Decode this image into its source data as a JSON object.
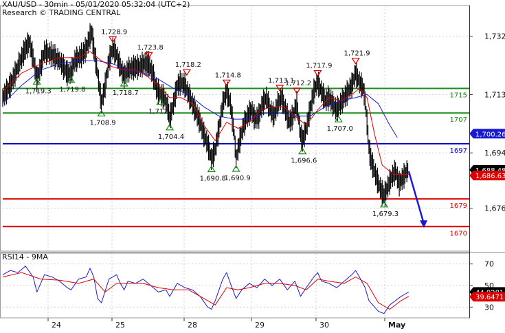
{
  "header": {
    "line1": "XAU/USD - 30min - 05/01/2020 05:32:04 (UTC+2)",
    "line2": "Research © TRADING CENTRAL"
  },
  "rsi_title": "RSI14 - 9MA",
  "colors": {
    "candle": "#000000",
    "fast_ma": "#dd0000",
    "slow_ma": "#1a1ad0",
    "support": "#1a8a1a",
    "resistance": "#dd0000",
    "pivot": "#0000cc",
    "price_tag": "#000000",
    "red_tag": "#dd0000",
    "blue_tag": "#1a1ad0",
    "grid": "#cfcfcf"
  },
  "chart_data": [
    {
      "type": "line",
      "name": "price",
      "ylim": [
        1662,
        1742
      ],
      "x_ticks": [
        "24",
        "25",
        "28",
        "29",
        "30",
        "May"
      ],
      "y_ticks": [
        1732,
        1713,
        1694,
        1676
      ],
      "horizontal_lines": [
        {
          "value": 1715,
          "label": "1715",
          "role": "support"
        },
        {
          "value": 1707,
          "label": "1707",
          "role": "support"
        },
        {
          "value": 1697,
          "label": "1697",
          "role": "pivot"
        },
        {
          "value": 1679,
          "label": "1679",
          "role": "resistance"
        },
        {
          "value": 1670,
          "label": "1670",
          "role": "resistance"
        }
      ],
      "price_tags": [
        {
          "label": "1,700.26",
          "value": 1700.26,
          "role": "blue"
        },
        {
          "label": "1,688.48",
          "value": 1688.48,
          "role": "black"
        },
        {
          "label": "1,686.63",
          "value": 1686.63,
          "role": "red"
        }
      ],
      "swing_highs": [
        {
          "label": "1,728.9",
          "x": 58,
          "y": 1728.9
        },
        {
          "label": "1,723.8",
          "x": 77,
          "y": 1723.8
        },
        {
          "label": "1,718.2",
          "x": 97,
          "y": 1718.2
        },
        {
          "label": "1,714.8",
          "x": 118,
          "y": 1714.8
        },
        {
          "label": "1,713.1",
          "x": 146,
          "y": 1713.1
        },
        {
          "label": "1,712.2",
          "x": 155,
          "y": 1712.2
        },
        {
          "label": "1,717.9",
          "x": 166,
          "y": 1717.9
        },
        {
          "label": "1,721.9",
          "x": 186,
          "y": 1721.9
        }
      ],
      "swing_lows": [
        {
          "label": "1,719.3",
          "x": 18,
          "y": 1719.3
        },
        {
          "label": "1,719.8",
          "x": 36,
          "y": 1719.8
        },
        {
          "label": "1,708.9",
          "x": 52,
          "y": 1708.9
        },
        {
          "label": "1,718.7",
          "x": 64,
          "y": 1718.7
        },
        {
          "label": "1,712.7",
          "x": 83,
          "y": 1712.7
        },
        {
          "label": "1,704.4",
          "x": 88,
          "y": 1704.4
        },
        {
          "label": "1,690.8",
          "x": 110,
          "y": 1690.8
        },
        {
          "label": "1,690.9",
          "x": 123,
          "y": 1690.9
        },
        {
          "label": "1,696.6",
          "x": 158,
          "y": 1696.6
        },
        {
          "label": "1,707.0",
          "x": 177,
          "y": 1707.0
        },
        {
          "label": "1,679.3",
          "x": 201,
          "y": 1679.3
        }
      ],
      "price_path": [
        [
          0,
          1712
        ],
        [
          4,
          1716
        ],
        [
          8,
          1722
        ],
        [
          12,
          1728
        ],
        [
          14,
          1730
        ],
        [
          16,
          1725
        ],
        [
          18,
          1718
        ],
        [
          20,
          1722
        ],
        [
          22,
          1727
        ],
        [
          26,
          1726
        ],
        [
          30,
          1724
        ],
        [
          34,
          1720
        ],
        [
          36,
          1720
        ],
        [
          38,
          1724
        ],
        [
          42,
          1726
        ],
        [
          44,
          1728
        ],
        [
          46,
          1732
        ],
        [
          47,
          1733
        ],
        [
          48,
          1728
        ],
        [
          50,
          1720
        ],
        [
          52,
          1710
        ],
        [
          54,
          1716
        ],
        [
          56,
          1724
        ],
        [
          58,
          1728
        ],
        [
          60,
          1726
        ],
        [
          62,
          1722
        ],
        [
          64,
          1719
        ],
        [
          66,
          1721
        ],
        [
          70,
          1722
        ],
        [
          72,
          1722
        ],
        [
          74,
          1723
        ],
        [
          77,
          1723
        ],
        [
          79,
          1720
        ],
        [
          81,
          1715
        ],
        [
          83,
          1713
        ],
        [
          85,
          1712
        ],
        [
          87,
          1709
        ],
        [
          88,
          1705
        ],
        [
          90,
          1710
        ],
        [
          92,
          1716
        ],
        [
          94,
          1717
        ],
        [
          96,
          1716
        ],
        [
          98,
          1713
        ],
        [
          100,
          1710
        ],
        [
          102,
          1707
        ],
        [
          104,
          1704
        ],
        [
          106,
          1700
        ],
        [
          108,
          1697
        ],
        [
          110,
          1692
        ],
        [
          112,
          1695
        ],
        [
          114,
          1702
        ],
        [
          116,
          1710
        ],
        [
          118,
          1714
        ],
        [
          120,
          1710
        ],
        [
          122,
          1700
        ],
        [
          123,
          1692
        ],
        [
          125,
          1698
        ],
        [
          127,
          1703
        ],
        [
          129,
          1706
        ],
        [
          131,
          1708
        ],
        [
          133,
          1705
        ],
        [
          135,
          1706
        ],
        [
          137,
          1710
        ],
        [
          139,
          1712
        ],
        [
          141,
          1708
        ],
        [
          143,
          1706
        ],
        [
          145,
          1710
        ],
        [
          147,
          1712
        ],
        [
          149,
          1708
        ],
        [
          151,
          1704
        ],
        [
          153,
          1706
        ],
        [
          155,
          1710
        ],
        [
          157,
          1700
        ],
        [
          158,
          1698
        ],
        [
          160,
          1702
        ],
        [
          162,
          1708
        ],
        [
          164,
          1714
        ],
        [
          166,
          1717
        ],
        [
          168,
          1714
        ],
        [
          170,
          1711
        ],
        [
          172,
          1712
        ],
        [
          174,
          1710
        ],
        [
          176,
          1708
        ],
        [
          178,
          1710
        ],
        [
          180,
          1712
        ],
        [
          182,
          1714
        ],
        [
          184,
          1716
        ],
        [
          186,
          1720
        ],
        [
          188,
          1717
        ],
        [
          190,
          1715
        ],
        [
          191,
          1711
        ],
        [
          192,
          1704
        ],
        [
          193,
          1696
        ],
        [
          194,
          1692
        ],
        [
          196,
          1688
        ],
        [
          198,
          1684
        ],
        [
          200,
          1681
        ],
        [
          201,
          1680
        ],
        [
          203,
          1683
        ],
        [
          205,
          1686
        ],
        [
          207,
          1688
        ],
        [
          209,
          1684
        ],
        [
          211,
          1686
        ],
        [
          213,
          1688
        ],
        [
          214,
          1688.5
        ]
      ],
      "fast_ma": [
        [
          0,
          1714
        ],
        [
          10,
          1720
        ],
        [
          20,
          1723
        ],
        [
          30,
          1725
        ],
        [
          40,
          1725
        ],
        [
          46,
          1727
        ],
        [
          52,
          1724
        ],
        [
          58,
          1722
        ],
        [
          64,
          1721
        ],
        [
          70,
          1721
        ],
        [
          76,
          1719
        ],
        [
          82,
          1716
        ],
        [
          88,
          1712
        ],
        [
          94,
          1712
        ],
        [
          100,
          1710
        ],
        [
          106,
          1703
        ],
        [
          112,
          1698
        ],
        [
          118,
          1704
        ],
        [
          124,
          1702
        ],
        [
          130,
          1704
        ],
        [
          136,
          1708
        ],
        [
          142,
          1709
        ],
        [
          148,
          1709
        ],
        [
          154,
          1706
        ],
        [
          160,
          1703
        ],
        [
          166,
          1708
        ],
        [
          172,
          1712
        ],
        [
          178,
          1711
        ],
        [
          184,
          1713
        ],
        [
          188,
          1715
        ],
        [
          192,
          1712
        ],
        [
          196,
          1700
        ],
        [
          200,
          1690
        ],
        [
          206,
          1687
        ],
        [
          212,
          1687
        ],
        [
          214,
          1687
        ]
      ],
      "slow_ma": [
        [
          0,
          1710
        ],
        [
          10,
          1716
        ],
        [
          20,
          1721
        ],
        [
          30,
          1723
        ],
        [
          40,
          1724
        ],
        [
          50,
          1724
        ],
        [
          58,
          1723
        ],
        [
          66,
          1721
        ],
        [
          74,
          1720
        ],
        [
          82,
          1718
        ],
        [
          90,
          1715
        ],
        [
          98,
          1713
        ],
        [
          106,
          1709
        ],
        [
          114,
          1706
        ],
        [
          122,
          1705
        ],
        [
          130,
          1705
        ],
        [
          138,
          1707
        ],
        [
          146,
          1707
        ],
        [
          154,
          1706
        ],
        [
          162,
          1706
        ],
        [
          170,
          1709
        ],
        [
          178,
          1711
        ],
        [
          186,
          1712
        ],
        [
          192,
          1713
        ],
        [
          198,
          1710
        ],
        [
          204,
          1703
        ],
        [
          208,
          1699
        ]
      ],
      "projection": [
        [
          214,
          1688
        ],
        [
          222,
          1670
        ]
      ]
    },
    {
      "type": "line",
      "name": "rsi",
      "title": "RSI14 - 9MA",
      "ylim": [
        20,
        80
      ],
      "y_ticks": [
        70,
        50,
        30
      ],
      "price_tags": [
        {
          "label": "44.0281",
          "value": 44.0281,
          "role": "black"
        },
        {
          "label": "39.6471",
          "value": 39.6471,
          "role": "red"
        }
      ],
      "rsi": [
        [
          0,
          60
        ],
        [
          4,
          64
        ],
        [
          8,
          62
        ],
        [
          12,
          68
        ],
        [
          16,
          58
        ],
        [
          18,
          44
        ],
        [
          22,
          60
        ],
        [
          26,
          58
        ],
        [
          30,
          54
        ],
        [
          34,
          48
        ],
        [
          36,
          46
        ],
        [
          40,
          56
        ],
        [
          44,
          58
        ],
        [
          46,
          66
        ],
        [
          48,
          58
        ],
        [
          50,
          38
        ],
        [
          52,
          34
        ],
        [
          56,
          56
        ],
        [
          60,
          60
        ],
        [
          62,
          52
        ],
        [
          64,
          46
        ],
        [
          66,
          54
        ],
        [
          70,
          52
        ],
        [
          74,
          56
        ],
        [
          78,
          50
        ],
        [
          82,
          44
        ],
        [
          86,
          46
        ],
        [
          88,
          40
        ],
        [
          92,
          52
        ],
        [
          96,
          48
        ],
        [
          100,
          46
        ],
        [
          104,
          40
        ],
        [
          108,
          30
        ],
        [
          110,
          28
        ],
        [
          112,
          36
        ],
        [
          116,
          56
        ],
        [
          118,
          62
        ],
        [
          120,
          52
        ],
        [
          123,
          38
        ],
        [
          126,
          46
        ],
        [
          130,
          52
        ],
        [
          134,
          48
        ],
        [
          138,
          56
        ],
        [
          142,
          50
        ],
        [
          146,
          56
        ],
        [
          150,
          46
        ],
        [
          154,
          54
        ],
        [
          157,
          40
        ],
        [
          160,
          48
        ],
        [
          164,
          58
        ],
        [
          166,
          62
        ],
        [
          168,
          54
        ],
        [
          172,
          52
        ],
        [
          176,
          48
        ],
        [
          180,
          54
        ],
        [
          184,
          60
        ],
        [
          186,
          64
        ],
        [
          188,
          58
        ],
        [
          191,
          48
        ],
        [
          193,
          36
        ],
        [
          196,
          30
        ],
        [
          198,
          26
        ],
        [
          201,
          24
        ],
        [
          204,
          32
        ],
        [
          207,
          36
        ],
        [
          210,
          40
        ],
        [
          212,
          42
        ],
        [
          214,
          44
        ]
      ],
      "ma": [
        [
          0,
          58
        ],
        [
          10,
          62
        ],
        [
          20,
          56
        ],
        [
          30,
          55
        ],
        [
          40,
          52
        ],
        [
          48,
          56
        ],
        [
          54,
          44
        ],
        [
          60,
          52
        ],
        [
          66,
          52
        ],
        [
          74,
          52
        ],
        [
          82,
          48
        ],
        [
          90,
          46
        ],
        [
          98,
          46
        ],
        [
          106,
          38
        ],
        [
          112,
          32
        ],
        [
          118,
          48
        ],
        [
          124,
          46
        ],
        [
          130,
          48
        ],
        [
          138,
          52
        ],
        [
          146,
          52
        ],
        [
          154,
          50
        ],
        [
          160,
          46
        ],
        [
          166,
          56
        ],
        [
          172,
          54
        ],
        [
          180,
          52
        ],
        [
          186,
          58
        ],
        [
          192,
          52
        ],
        [
          198,
          34
        ],
        [
          204,
          28
        ],
        [
          210,
          36
        ],
        [
          214,
          40
        ]
      ]
    }
  ]
}
